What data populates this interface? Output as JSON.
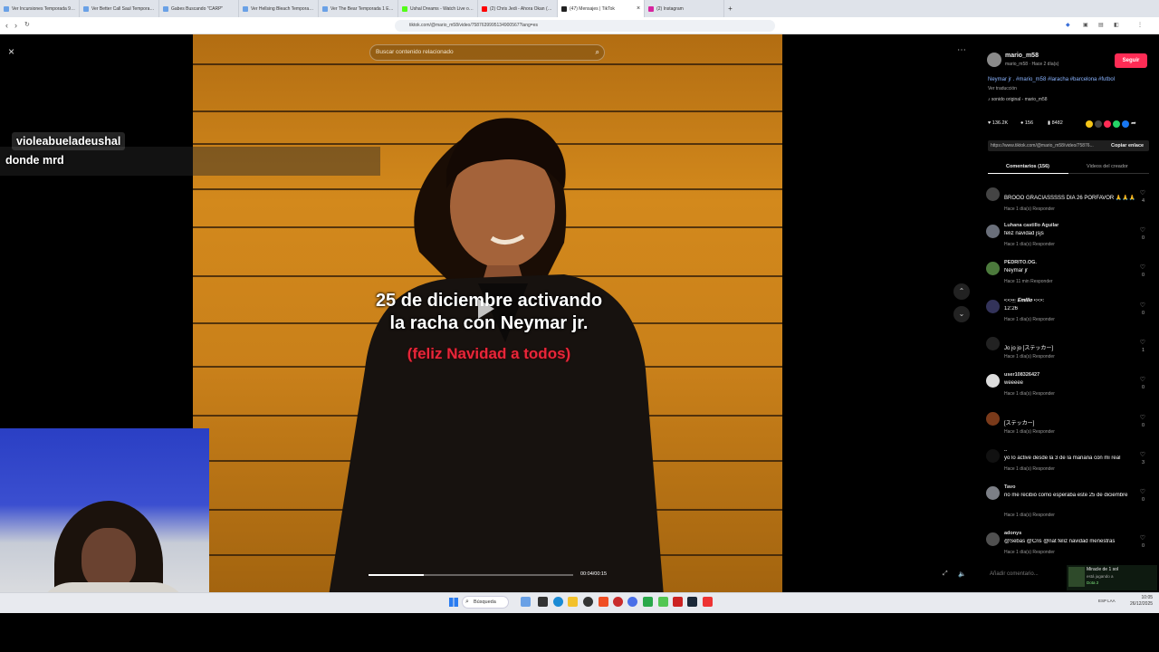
{
  "browser": {
    "tabs": [
      {
        "label": "Ver Incursiones Temporada 9 Episodio",
        "color": "#6aa1e6"
      },
      {
        "label": "Ver Better Call Saul Temporada 2 Episodio",
        "color": "#6aa1e6"
      },
      {
        "label": "Gabes Buscando \"CARP\"",
        "color": "#6aa1e6"
      },
      {
        "label": "Ver Hellsing Bleach Temporada 2 Episodio",
        "color": "#6aa1e6"
      },
      {
        "label": "Ver The Bear Temporada 1 Episodio",
        "color": "#6aa1e6"
      },
      {
        "label": "Ushal Dreams - Watch Live on Kick",
        "color": "#53fc18"
      },
      {
        "label": "(2) Chris Jedi - Ahora Okan (Official Video)",
        "color": "#ff0000"
      },
      {
        "label": "(47) Mensajes | TikTok",
        "color": "#222222",
        "active": true
      },
      {
        "label": "(2) Instagram",
        "color": "#d6249f"
      }
    ],
    "url": "tiktok.com/@mario_m58/video/7587639995134900567?lang=es"
  },
  "video": {
    "search_placeholder": "Buscar contenido relacionado",
    "caption_line1": "25 de diciembre activando",
    "caption_line2": "la racha con Neymar jr.",
    "caption_sub": "(feliz Navidad a todos)",
    "time": "00:04/00:15",
    "progress": 0.27
  },
  "overlay": {
    "chat_user": "violeabueladeushal",
    "chat_message": "donde mrd",
    "close": "×"
  },
  "panel": {
    "username": "mario_m58",
    "subline": "mario_m58 · Hace 2 día(s)",
    "follow": "Seguir",
    "description": "Neymar jr . #mario_m58 #laracha #barcelona #futbol",
    "translate": "Ver traducción",
    "sound": "sonido original - mario_m58",
    "likes": "136.2K",
    "comments_count": "156",
    "saves": "8482",
    "link": "https://www.tiktok.com/@mario_m58/video/75876...",
    "copy_link": "Copiar enlace",
    "tab_comments": "Comentarios (156)",
    "tab_creator": "Videos del creador",
    "add_comment": "Añadir comentario...",
    "mini_title": "Miracle de 1 sol",
    "mini_sub": "está jugando a",
    "mini_game": "Dota 2"
  },
  "comments": [
    {
      "user": "",
      "text": "BROOO GRACIASSSSS DIA 26 PORFAVOR 🙏🙏🙏",
      "meta": "Hace 1 día(s)   Responder",
      "count": "4",
      "avatar": "#444"
    },
    {
      "user": "Luhana castillo Aguilar",
      "text": "feliz navidad jsjs",
      "meta": "Hace 1 día(s)   Responder",
      "count": "0",
      "avatar": "#6a6f7a"
    },
    {
      "user": "PEDRITO.OG.",
      "text": "Neymar jr",
      "meta": "Hace 11 min   Responder",
      "count": "0",
      "avatar": "#4c7a3c"
    },
    {
      "user": "•:•:•̲•̲· 𝑬𝒎𝒊𝒍𝒊𝒐 •:•:•:",
      "text": "12:26",
      "meta": "Hace 1 día(s)   Responder",
      "count": "0",
      "avatar": "#33335a"
    },
    {
      "user": "",
      "text": "Jo jo jo [ステッカー]",
      "meta": "Hace 1 día(s)   Responder",
      "count": "1",
      "avatar": "#222"
    },
    {
      "user": "user108326427",
      "text": "weeeee",
      "meta": "Hace 1 día(s)   Responder",
      "count": "0",
      "avatar": "#ddd"
    },
    {
      "user": "",
      "text": "[ステッカー]",
      "meta": "Hace 1 día(s)   Responder",
      "count": "0",
      "avatar": "#7a3a1a"
    },
    {
      "user": "..",
      "text": "yo lo active desde la 3 de la mañana con mi real",
      "meta": "Hace 1 día(s)   Responder",
      "count": "3",
      "avatar": "#111"
    },
    {
      "user": "Tavo",
      "text": "no me recibió como esperaba este 25 de diciembre",
      "meta": "Hace 1 día(s)   Responder",
      "count": "0",
      "avatar": "#7c7f86"
    },
    {
      "user": "adonys",
      "text": "@Sebas @Cris @nat feliz navidad menestras",
      "meta": "Hace 1 día(s)   Responder",
      "count": "0",
      "avatar": "#505050"
    }
  ],
  "taskbar": {
    "search": "Búsqueda",
    "time": "10:05",
    "date": "26/12/2025",
    "lang": "ESP LAA"
  }
}
